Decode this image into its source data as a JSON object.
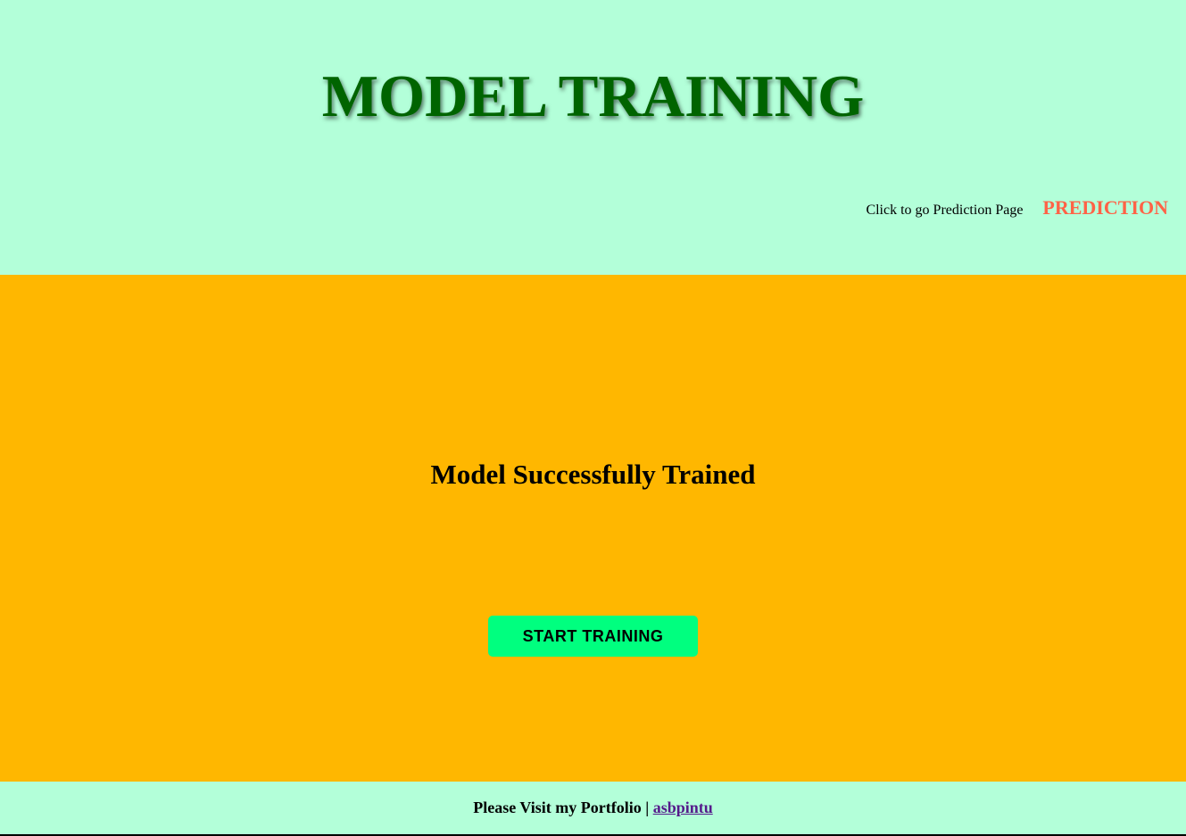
{
  "header": {
    "title": "MODEL TRAINING",
    "nav_hint": "Click to go Prediction Page",
    "nav_link": "PREDICTION"
  },
  "main": {
    "status_message": "Model Successfully Trained",
    "button_label": "START TRAINING"
  },
  "footer": {
    "text": "Please Visit my Portfolio",
    "separator": "|",
    "link_text": "asbpintu"
  },
  "colors": {
    "header_bg": "#b3ffd9",
    "title": "#006400",
    "nav_link": "#ff6347",
    "main_bg": "#ffb700",
    "button_bg": "#00ff7f",
    "footer_link": "#551a8b"
  }
}
